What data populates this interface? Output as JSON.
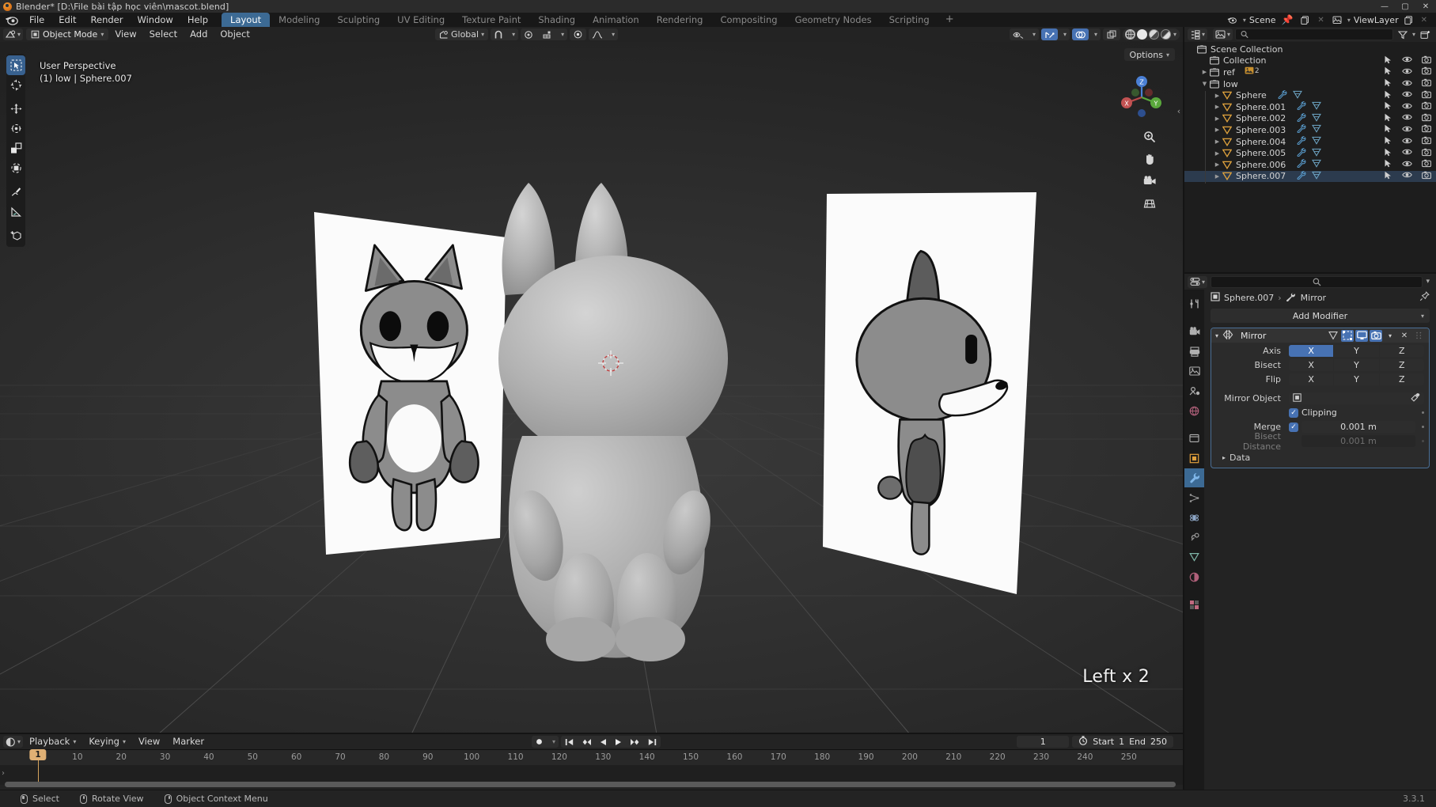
{
  "window": {
    "title": "Blender* [D:\\File bài tập học viên\\mascot.blend]",
    "minimize": "—",
    "maximize": "▢",
    "close": "✕"
  },
  "topbar": {
    "menus": [
      "File",
      "Edit",
      "Render",
      "Window",
      "Help"
    ],
    "workspaces": [
      {
        "label": "Layout",
        "active": true
      },
      {
        "label": "Modeling",
        "active": false
      },
      {
        "label": "Sculpting",
        "active": false
      },
      {
        "label": "UV Editing",
        "active": false
      },
      {
        "label": "Texture Paint",
        "active": false
      },
      {
        "label": "Shading",
        "active": false
      },
      {
        "label": "Animation",
        "active": false
      },
      {
        "label": "Rendering",
        "active": false
      },
      {
        "label": "Compositing",
        "active": false
      },
      {
        "label": "Geometry Nodes",
        "active": false
      },
      {
        "label": "Scripting",
        "active": false
      }
    ],
    "add_workspace": "+",
    "scene_name": "Scene",
    "viewlayer_name": "ViewLayer"
  },
  "viewport_header": {
    "mode": "Object Mode",
    "menus": [
      "View",
      "Select",
      "Add",
      "Object"
    ],
    "transform_orientation": "Global",
    "snap_label": "snap-magnet",
    "proportional_label": "proportional-editing"
  },
  "viewport": {
    "options_label": "Options",
    "overlay_line1": "User Perspective",
    "overlay_line2": "(1) low | Sphere.007",
    "corner_text": "Left x 2",
    "gizmo_axes": {
      "x": "X",
      "y": "Y",
      "z": "Z"
    }
  },
  "outliner": {
    "display_mode": "View Layer",
    "search_placeholder": "",
    "rows": [
      {
        "label": "Scene Collection",
        "indent": 0,
        "icon": "collection-icon",
        "expander": "none",
        "selected": false,
        "toggles": false
      },
      {
        "label": "Collection",
        "indent": 1,
        "icon": "collection-icon",
        "expander": "none",
        "selected": false,
        "toggles": true
      },
      {
        "label": "ref",
        "indent": 1,
        "icon": "collection-icon",
        "expander": "closed",
        "selected": false,
        "toggles": true,
        "badge": "2"
      },
      {
        "label": "low",
        "indent": 1,
        "icon": "collection-icon",
        "expander": "open",
        "selected": false,
        "toggles": true
      },
      {
        "label": "Sphere",
        "indent": 2,
        "icon": "mesh-icon",
        "expander": "closed",
        "selected": false,
        "toggles": true
      },
      {
        "label": "Sphere.001",
        "indent": 2,
        "icon": "mesh-icon",
        "expander": "closed",
        "selected": false,
        "toggles": true
      },
      {
        "label": "Sphere.002",
        "indent": 2,
        "icon": "mesh-icon",
        "expander": "closed",
        "selected": false,
        "toggles": true
      },
      {
        "label": "Sphere.003",
        "indent": 2,
        "icon": "mesh-icon",
        "expander": "closed",
        "selected": false,
        "toggles": true
      },
      {
        "label": "Sphere.004",
        "indent": 2,
        "icon": "mesh-icon",
        "expander": "closed",
        "selected": false,
        "toggles": true
      },
      {
        "label": "Sphere.005",
        "indent": 2,
        "icon": "mesh-icon",
        "expander": "closed",
        "selected": false,
        "toggles": true
      },
      {
        "label": "Sphere.006",
        "indent": 2,
        "icon": "mesh-icon",
        "expander": "closed",
        "selected": false,
        "toggles": true
      },
      {
        "label": "Sphere.007",
        "indent": 2,
        "icon": "mesh-icon",
        "expander": "closed",
        "selected": true,
        "toggles": true
      }
    ]
  },
  "properties": {
    "breadcrumb_object": "Sphere.007",
    "breadcrumb_sep": "›",
    "breadcrumb_modifier": "Mirror",
    "add_modifier": "Add Modifier",
    "modifier": {
      "name": "Mirror",
      "axis_label": "Axis",
      "axis_options": [
        "X",
        "Y",
        "Z"
      ],
      "axis_active": "X",
      "bisect_label": "Bisect",
      "bisect_options": [
        "X",
        "Y",
        "Z"
      ],
      "bisect_active": "",
      "flip_label": "Flip",
      "flip_options": [
        "X",
        "Y",
        "Z"
      ],
      "flip_active": "",
      "mirror_object_label": "Mirror Object",
      "mirror_object_value": "",
      "clipping_label": "Clipping",
      "clipping_checked": true,
      "merge_label": "Merge",
      "merge_checked": true,
      "merge_value": "0.001 m",
      "bisect_distance_label": "Bisect Distance",
      "bisect_distance_value": "0.001 m",
      "data_label": "Data"
    }
  },
  "timeline": {
    "editor_label": "timeline-editor",
    "menus": [
      "Playback",
      "Keying",
      "View",
      "Marker"
    ],
    "ticks": [
      10,
      20,
      30,
      40,
      50,
      60,
      70,
      80,
      90,
      100,
      110,
      120,
      130,
      140,
      150,
      160,
      170,
      180,
      190,
      200,
      210,
      220,
      230,
      240,
      250
    ],
    "current_frame": "1",
    "current_frame_marker": "1",
    "start_label": "Start",
    "start_value": "1",
    "end_label": "End",
    "end_value": "250",
    "playback_buttons": [
      "jump-start",
      "prev-keyframe",
      "play-reverse",
      "play",
      "next-keyframe",
      "jump-end"
    ]
  },
  "statusbar": {
    "items": [
      {
        "mouse": "left",
        "label": "Select"
      },
      {
        "mouse": "middle",
        "label": "Rotate View"
      },
      {
        "mouse": "right",
        "label": "Object Context Menu"
      }
    ],
    "version": "3.3.1"
  },
  "colors": {
    "accent_blue": "#4772b3",
    "tab_active": "#3c6a94",
    "playhead": "#e0b074",
    "mesh_orange": "#e8a33d",
    "panel_bg": "#232323",
    "editor_bg": "#1d1d1d"
  }
}
